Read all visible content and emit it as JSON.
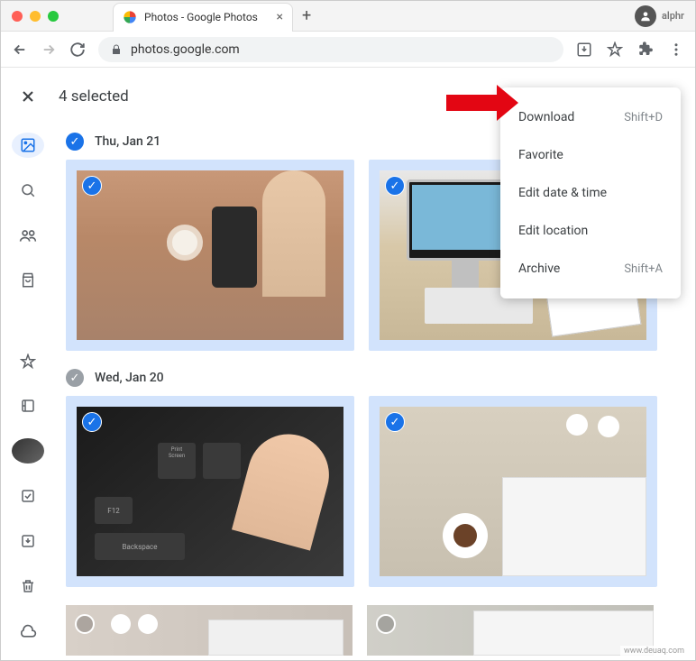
{
  "window": {
    "tab_title": "Photos - Google Photos",
    "url": "photos.google.com"
  },
  "selection_header": {
    "text": "4 selected"
  },
  "context_menu": {
    "items": [
      {
        "label": "Download",
        "shortcut": "Shift+D"
      },
      {
        "label": "Favorite",
        "shortcut": ""
      },
      {
        "label": "Edit date & time",
        "shortcut": ""
      },
      {
        "label": "Edit location",
        "shortcut": ""
      },
      {
        "label": "Archive",
        "shortcut": "Shift+A"
      }
    ]
  },
  "dates": [
    {
      "label": "Thu, Jan 21",
      "checked": true
    },
    {
      "label": "Wed, Jan 20",
      "checked": false
    }
  ],
  "watermark": "www.deuaq.com"
}
